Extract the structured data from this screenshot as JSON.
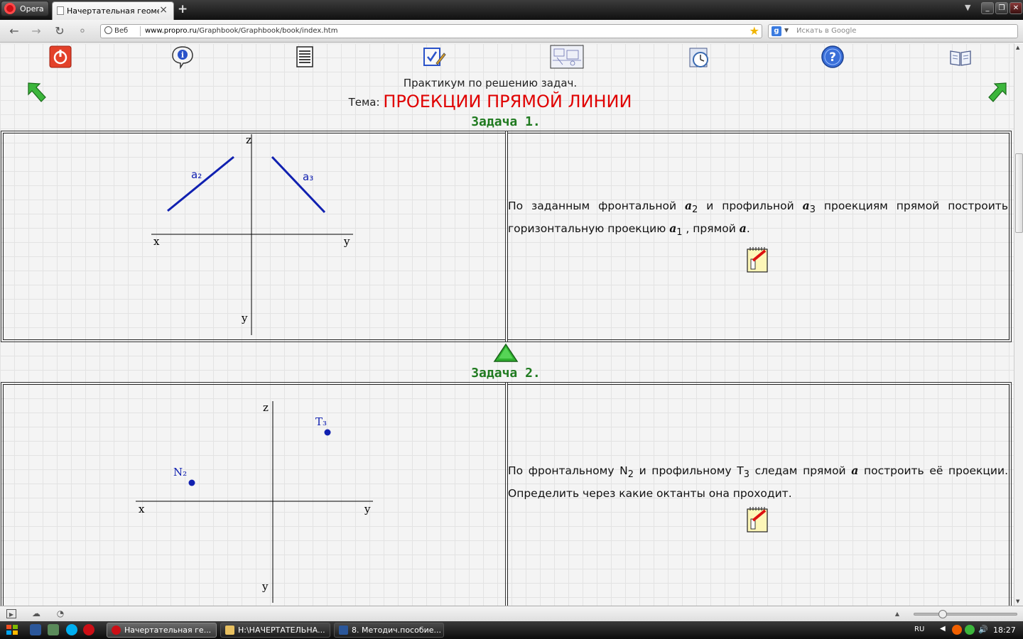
{
  "browser": {
    "menu_label": "Opera",
    "tab_title": "Начертательная геоме...",
    "tab_close": "×",
    "new_tab": "+",
    "address_prefix": "Веб",
    "url_host": "www.propro.ru",
    "url_path": "/Graphbook/Graphbook/book/index.htm",
    "search_placeholder": "Искать в Google",
    "search_engine_icon": "g",
    "window_minimize": "_",
    "window_restore": "❐",
    "window_close": "✕"
  },
  "toolbar": {
    "icons": [
      "power-icon",
      "info-icon",
      "document-icon",
      "edit-check-icon",
      "drawing-thumbnail-icon",
      "clock-icon",
      "help-icon",
      "book-icon"
    ],
    "help_glyph": "?"
  },
  "header": {
    "subtitle": "Практикум по решению задач.",
    "tema_label": "Тема:",
    "tema_title": "ПРОЕКЦИИ ПРЯМОЙ ЛИНИИ"
  },
  "tasks": [
    {
      "title": "Задача 1.",
      "axis": {
        "z": "z",
        "x": "x",
        "y_right": "y",
        "y_bottom": "y"
      },
      "labels": {
        "a2": "a₂",
        "a3": "a₃"
      },
      "desc_line1_parts": [
        "По заданным фронтальной",
        "a",
        "2",
        "и профильной",
        "a",
        "3",
        "проекциям прямой построить"
      ],
      "desc_line2_parts": [
        "горизонтальную проекцию",
        "a",
        "1",
        ", прямой",
        "a",
        "."
      ]
    },
    {
      "title": "Задача 2.",
      "axis": {
        "z": "z",
        "x": "x",
        "y_right": "y",
        "y_bottom": "y"
      },
      "labels": {
        "n2": "N₂",
        "t3": "T₃"
      },
      "desc_line1_parts": [
        "По фронтальному N",
        "2",
        "и профильному T",
        "3",
        "следам прямой",
        "a",
        "построить её проекции."
      ],
      "desc_line2": "Определить через какие октанты она проходит."
    }
  ],
  "taskbar": {
    "tasks": [
      "Начертательная ге...",
      "H:\\НАЧЕРТАТЕЛЬНА...",
      "8. Методич.пособие..."
    ],
    "lang": "RU",
    "time": "18:27"
  },
  "colors": {
    "title_red": "#e00000",
    "task_green": "#1f7a1f",
    "line_blue": "#1020b0"
  }
}
